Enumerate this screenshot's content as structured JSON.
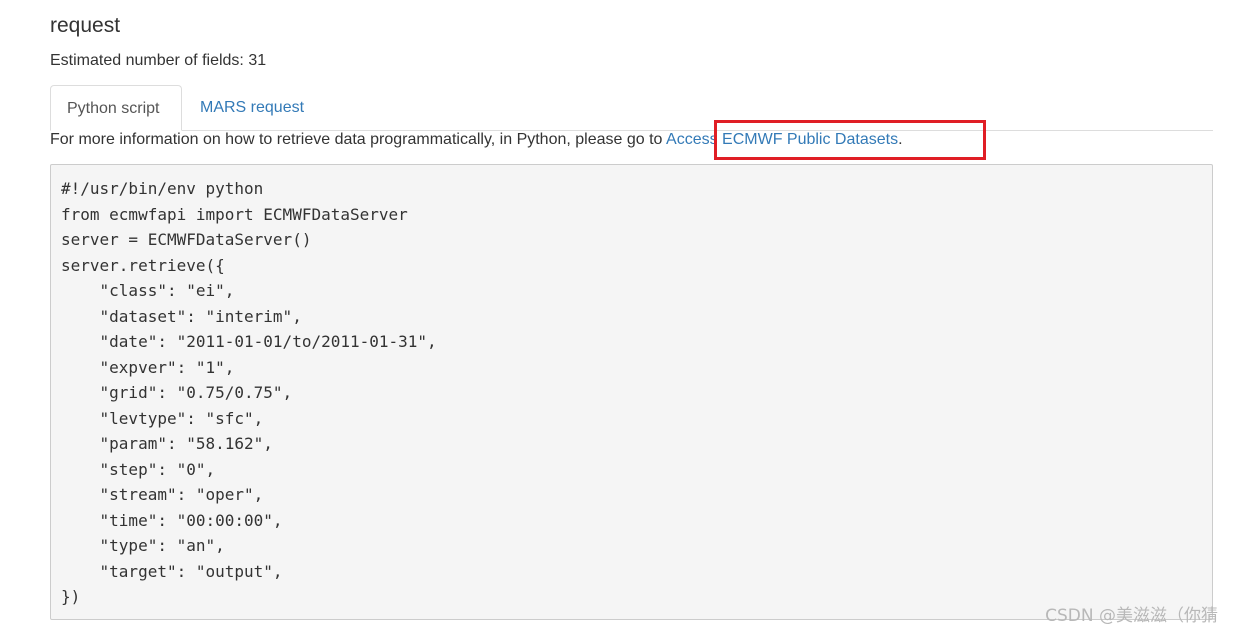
{
  "section": {
    "title": "request",
    "field_count_text": "Estimated number of fields: 31"
  },
  "tabs": [
    {
      "label": "Python script",
      "active": true
    },
    {
      "label": "MARS request",
      "active": false
    }
  ],
  "info": {
    "prefix": "For more information on how to retrieve data programmatically, in Python, please go to ",
    "link_text": "Access ECMWF Public Datasets",
    "suffix": "."
  },
  "code": {
    "lines": [
      "#!/usr/bin/env python",
      "from ecmwfapi import ECMWFDataServer",
      "server = ECMWFDataServer()",
      "server.retrieve({",
      "    \"class\": \"ei\",",
      "    \"dataset\": \"interim\",",
      "    \"date\": \"2011-01-01/to/2011-01-31\",",
      "    \"expver\": \"1\",",
      "    \"grid\": \"0.75/0.75\",",
      "    \"levtype\": \"sfc\",",
      "    \"param\": \"58.162\",",
      "    \"step\": \"0\",",
      "    \"stream\": \"oper\",",
      "    \"time\": \"00:00:00\",",
      "    \"type\": \"an\",",
      "    \"target\": \"output\",",
      "})"
    ]
  },
  "watermark": "CSDN @美滋滋（你猜",
  "colors": {
    "link": "#337ab7",
    "highlight": "#e01e25",
    "code_bg": "#f5f5f5"
  }
}
